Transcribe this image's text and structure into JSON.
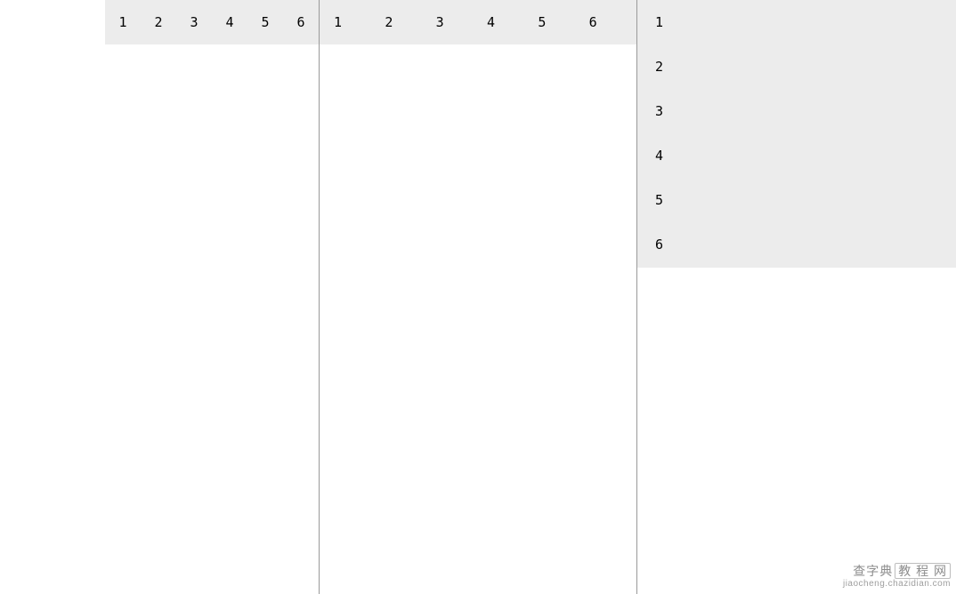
{
  "panel1": {
    "items": [
      "1",
      "2",
      "3",
      "4",
      "5",
      "6"
    ]
  },
  "panel2": {
    "items": [
      "1",
      "2",
      "3",
      "4",
      "5",
      "6"
    ]
  },
  "panel3": {
    "items": [
      "1",
      "2",
      "3",
      "4",
      "5",
      "6"
    ]
  },
  "watermark": {
    "line1_a": "查字典",
    "line1_b": "教 程 网",
    "line2": "jiaocheng.chazidian.com"
  }
}
